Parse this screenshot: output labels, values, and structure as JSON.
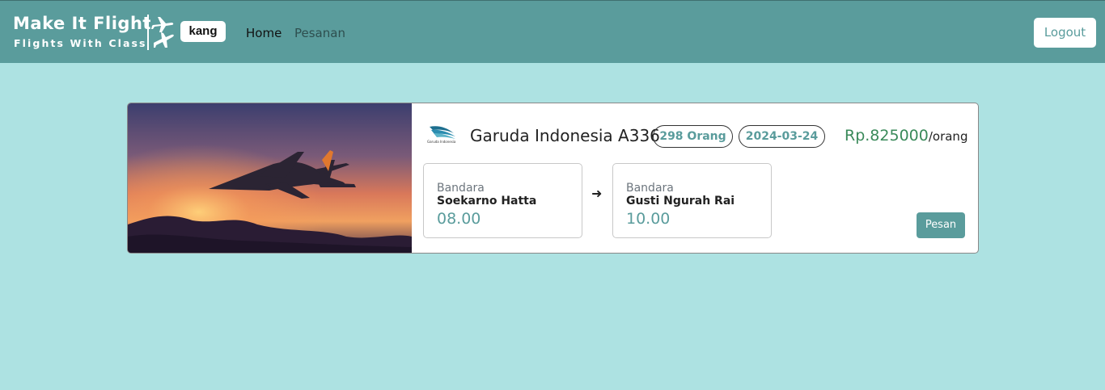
{
  "navbar": {
    "brand_title": "Make It Flight",
    "brand_subtitle": "Flights With Class",
    "username": "kang",
    "links": [
      {
        "label": "Home"
      },
      {
        "label": "Pesanan"
      }
    ],
    "logout_label": "Logout"
  },
  "flight": {
    "airline_logo_text": "Garuda Indonesia",
    "name": "Garuda Indonesia A336",
    "seats": "298 Orang",
    "date": "2024-03-24",
    "price": "Rp.825000",
    "price_unit": "/orang",
    "departure": {
      "label": "Bandara",
      "airport": "Soekarno Hatta",
      "time": "08.00"
    },
    "arrival": {
      "label": "Bandara",
      "airport": "Gusti Ngurah Rai",
      "time": "10.00"
    },
    "arrow_icon": "arrow-right-icon",
    "book_label": "Pesan"
  },
  "colors": {
    "page_bg": "#ade2e2",
    "navbar_bg": "#5a9c9c",
    "accent": "#5a9c9c",
    "price": "#3a8a5a"
  }
}
